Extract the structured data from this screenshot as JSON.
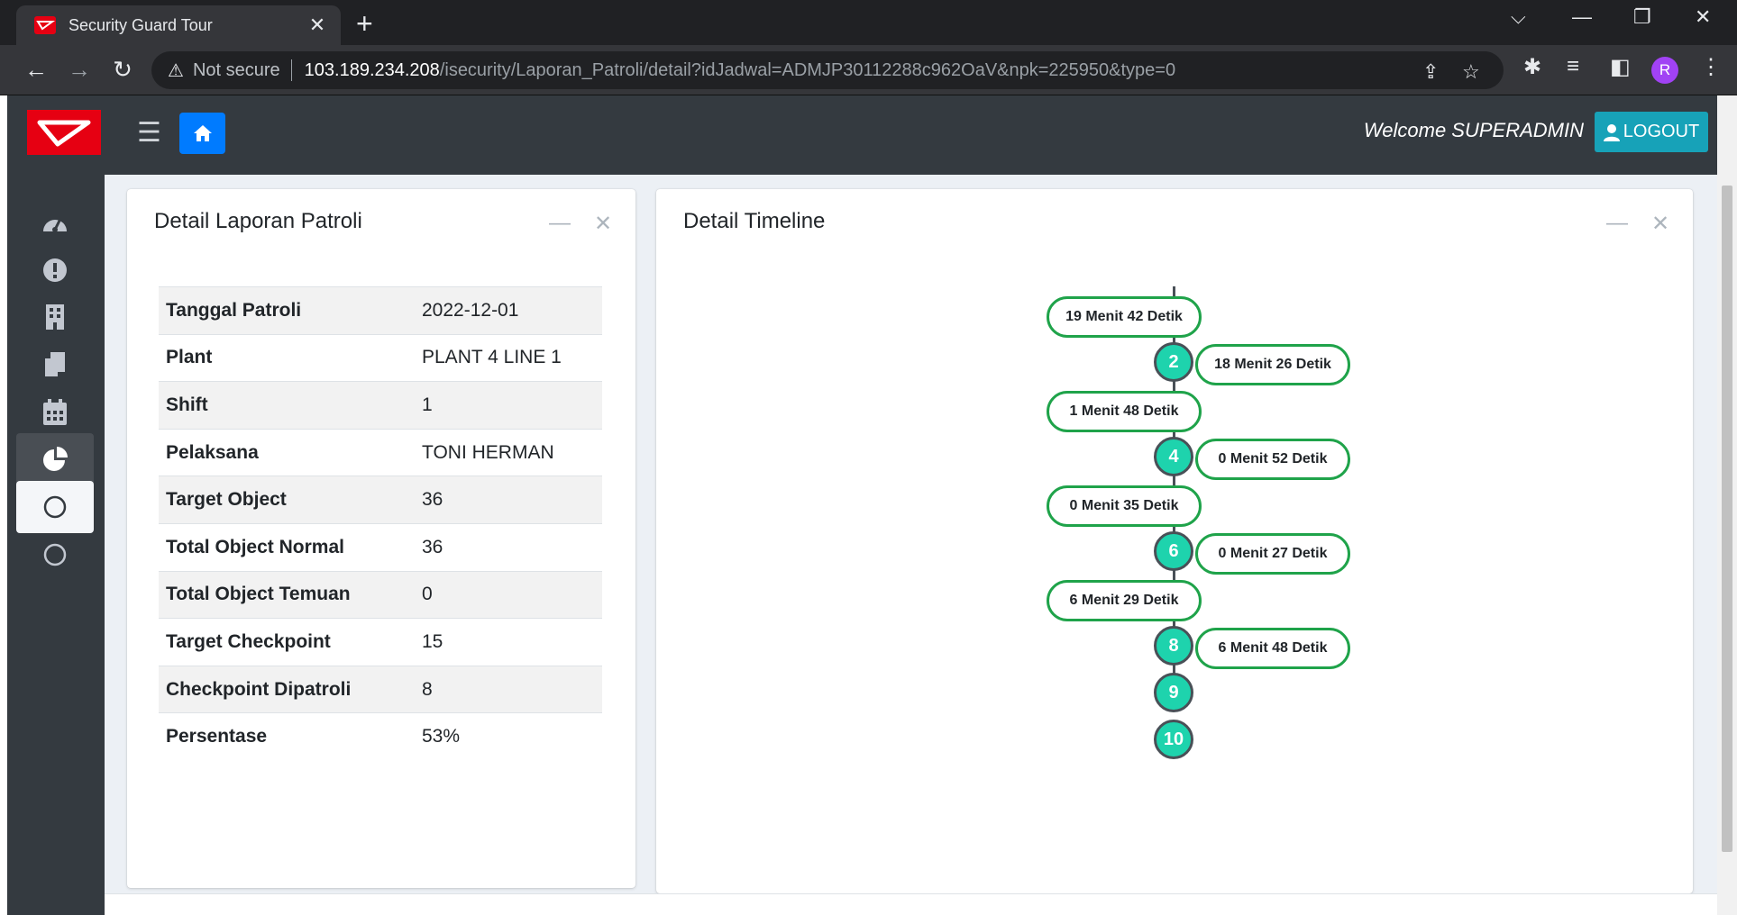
{
  "browser": {
    "tab_title": "Security Guard Tour",
    "security_label": "Not secure",
    "url_host": "103.189.234.208",
    "url_path": "/isecurity/Laporan_Patroli/detail?idJadwal=ADMJP30112288c962OaV&npk=225950&type=0",
    "profile_initial": "R"
  },
  "header": {
    "welcome": "Welcome SUPERADMIN",
    "logout_label": "LOGOUT"
  },
  "sidebar": {
    "items": [
      {
        "icon": "dashboard-icon"
      },
      {
        "icon": "alert-icon"
      },
      {
        "icon": "building-icon"
      },
      {
        "icon": "documents-icon"
      },
      {
        "icon": "calendar-icon"
      },
      {
        "icon": "pie-chart-icon",
        "state": "active-dark"
      },
      {
        "icon": "circle-icon",
        "state": "active"
      },
      {
        "icon": "circle-icon"
      }
    ]
  },
  "report": {
    "title": "Detail Laporan Patroli",
    "rows": [
      {
        "label": "Tanggal Patroli",
        "value": "2022-12-01"
      },
      {
        "label": "Plant",
        "value": "PLANT 4 LINE 1"
      },
      {
        "label": "Shift",
        "value": "1"
      },
      {
        "label": "Pelaksana",
        "value": "TONI HERMAN"
      },
      {
        "label": "Target Object",
        "value": "36"
      },
      {
        "label": "Total Object Normal",
        "value": "36"
      },
      {
        "label": "Total Object Temuan",
        "value": "0"
      },
      {
        "label": "Target Checkpoint",
        "value": "15"
      },
      {
        "label": "Checkpoint Dipatroli",
        "value": "8"
      },
      {
        "label": "Persentase",
        "value": "53%"
      }
    ]
  },
  "timeline": {
    "title": "Detail Timeline",
    "nodes": [
      "2",
      "4",
      "6",
      "8",
      "9",
      "10"
    ],
    "labels": [
      "19 Menit 42 Detik",
      "18 Menit 26 Detik",
      "1 Menit 48 Detik",
      "0 Menit 52 Detik",
      "0 Menit 35 Detik",
      "0 Menit 27 Detik",
      "6 Menit 29 Detik",
      "6 Menit 48 Detik"
    ]
  }
}
